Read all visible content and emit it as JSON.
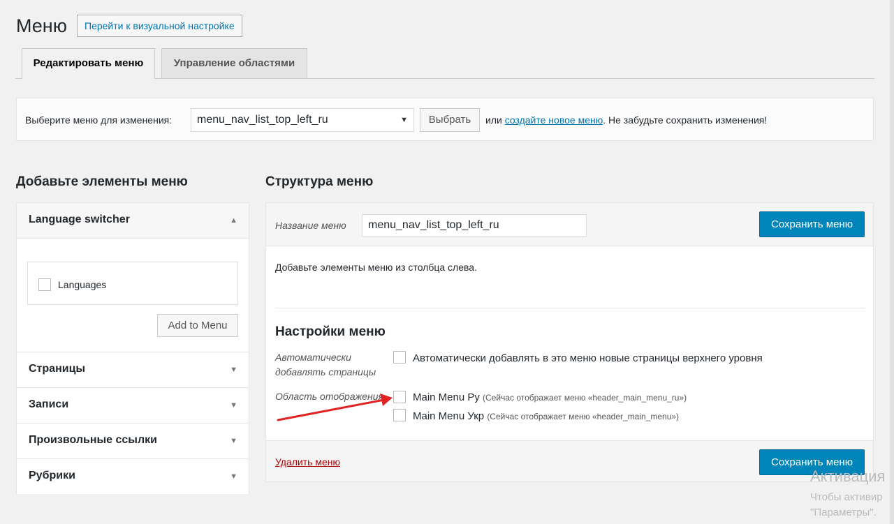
{
  "header": {
    "title": "Меню",
    "visual_button": "Перейти к визуальной настройке"
  },
  "tabs": [
    {
      "label": "Редактировать меню",
      "active": true
    },
    {
      "label": "Управление областями",
      "active": false
    }
  ],
  "select_menu": {
    "label": "Выберите меню для изменения:",
    "selected": "menu_nav_list_top_left_ru",
    "select_button": "Выбрать",
    "note_prefix": "или",
    "create_link": "создайте новое меню",
    "note_suffix": ". Не забудьте сохранить изменения!"
  },
  "add_items": {
    "heading": "Добавьте элементы меню",
    "sections": [
      {
        "title": "Language switcher",
        "expanded": true
      },
      {
        "title": "Страницы",
        "expanded": false
      },
      {
        "title": "Записи",
        "expanded": false
      },
      {
        "title": "Произвольные ссылки",
        "expanded": false
      },
      {
        "title": "Рубрики",
        "expanded": false
      }
    ],
    "languages_label": "Languages",
    "add_button": "Add to Menu"
  },
  "structure": {
    "heading": "Структура меню",
    "name_label": "Название меню",
    "name_value": "menu_nav_list_top_left_ru",
    "save_button": "Сохранить меню",
    "hint": "Добавьте элементы меню из столбца слева.",
    "settings_title": "Настройки меню",
    "auto_add_label": "Автоматически добавлять страницы",
    "auto_add_text": "Автоматически добавлять в это меню новые страницы верхнего уровня",
    "area_label": "Область отображения",
    "locations": [
      {
        "name": "Main Menu Ру",
        "note": "(Сейчас отображает меню «header_main_menu_ru»)"
      },
      {
        "name": "Main Menu Укр",
        "note": "(Сейчас отображает меню «header_main_menu»)"
      }
    ],
    "delete_link": "Удалить меню"
  },
  "watermark": {
    "line1": "Активация",
    "line2": "Чтобы активир",
    "line3": "\"Параметры\"."
  },
  "colors": {
    "primary": "#0085ba",
    "link": "#0073aa",
    "delete": "#a00000",
    "annotation_arrow": "#e02424"
  }
}
